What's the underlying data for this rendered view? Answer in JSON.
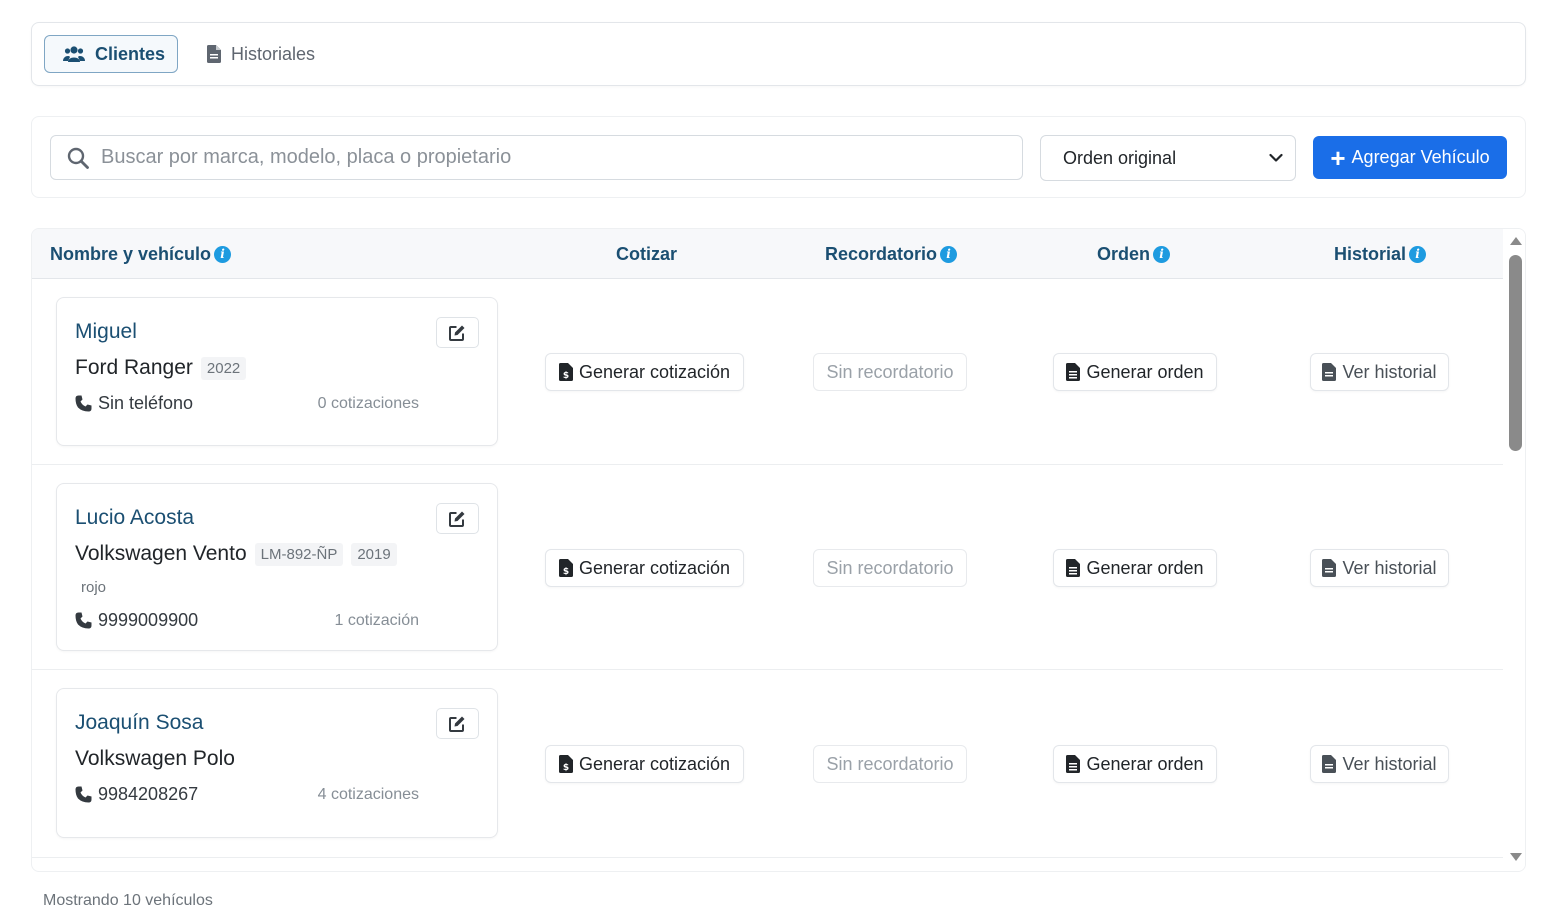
{
  "tabs": [
    {
      "label": "Clientes",
      "icon": "users-icon",
      "active": true
    },
    {
      "label": "Historiales",
      "icon": "file-icon",
      "active": false
    }
  ],
  "filters": {
    "search_placeholder": "Buscar por marca, modelo, placa o propietario",
    "search_value": "",
    "sort_selected": "Orden original",
    "add_button_label": "Agregar Vehículo"
  },
  "table": {
    "headers": {
      "name_vehicle": "Nombre y vehículo",
      "quote": "Cotizar",
      "reminder": "Recordatorio",
      "order": "Orden",
      "history": "Historial"
    },
    "rows": [
      {
        "name": "Miguel",
        "vehicle": "Ford Ranger",
        "plate": "",
        "year": "2022",
        "color": "",
        "phone": "Sin teléfono",
        "quotes": "0 cotizaciones",
        "quote_button": "Generar cotización",
        "reminder": "Sin recordatorio",
        "order_button": "Generar orden",
        "history_button": "Ver historial"
      },
      {
        "name": "Lucio Acosta",
        "vehicle": "Volkswagen Vento",
        "plate": "LM-892-ÑP",
        "year": "2019",
        "color": "rojo",
        "phone": "9999009900",
        "quotes": "1 cotización",
        "quote_button": "Generar cotización",
        "reminder": "Sin recordatorio",
        "order_button": "Generar orden",
        "history_button": "Ver historial"
      },
      {
        "name": "Joaquín Sosa",
        "vehicle": "Volkswagen Polo",
        "plate": "",
        "year": "",
        "color": "",
        "phone": "9984208267",
        "quotes": "4 cotizaciones",
        "quote_button": "Generar cotización",
        "reminder": "Sin recordatorio",
        "order_button": "Generar orden",
        "history_button": "Ver historial"
      }
    ]
  },
  "footer": {
    "status": "Mostrando 10 vehículos"
  },
  "colors": {
    "primary": "#1a6ee8",
    "heading": "#1b4f72",
    "info": "#1e9be0"
  }
}
